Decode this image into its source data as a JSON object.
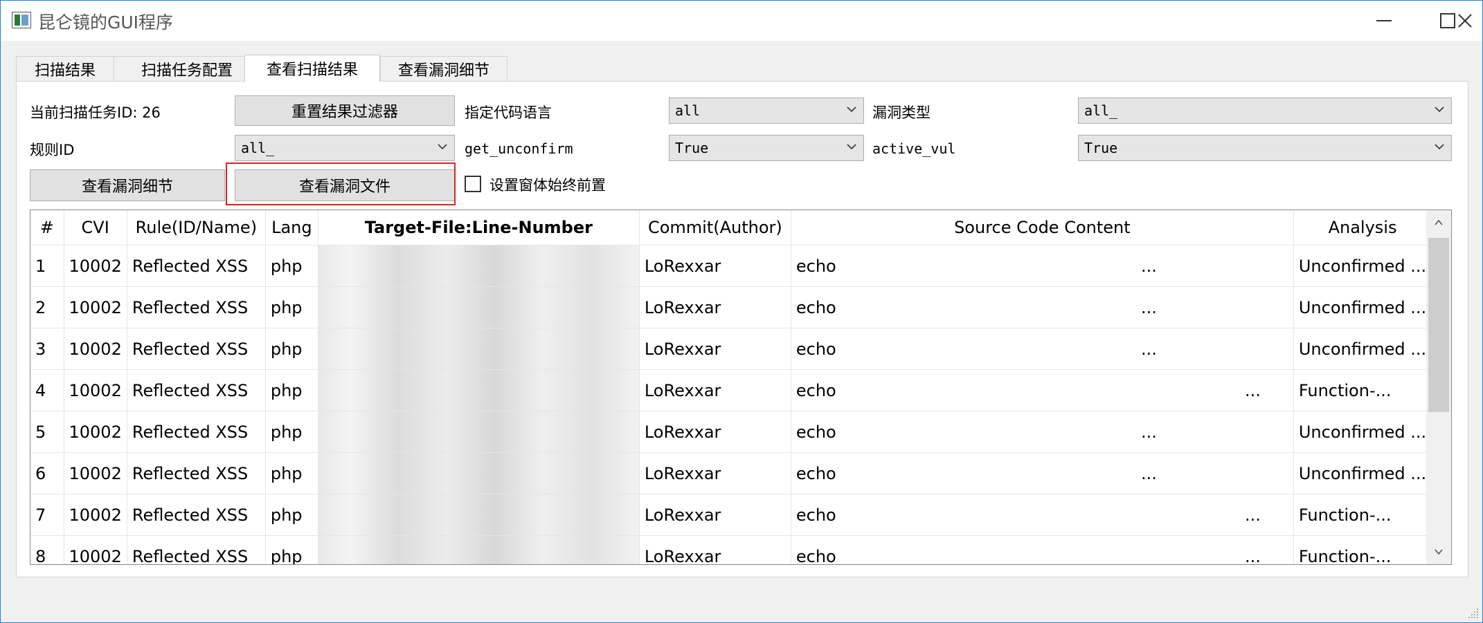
{
  "window": {
    "title": "昆仑镜的GUI程序"
  },
  "tabs": [
    {
      "label": "扫描结果",
      "active": false
    },
    {
      "label": "扫描任务配置",
      "active": false
    },
    {
      "label": "查看扫描结果",
      "active": true
    },
    {
      "label": "查看漏洞细节",
      "active": false
    }
  ],
  "controls": {
    "task_id_label": "当前扫描任务ID: 26",
    "reset_filter_button": "重置结果过滤器",
    "code_language_label": "指定代码语言",
    "code_language_value": "all",
    "vuln_type_label": "漏洞类型",
    "vuln_type_value": "all_",
    "rule_id_label": "规则ID",
    "rule_id_value": "all_",
    "get_unconfirm_label": "get_unconfirm",
    "get_unconfirm_value": "True",
    "active_vul_label": "active_vul",
    "active_vul_value": "True",
    "view_vuln_detail_button": "查看漏洞细节",
    "view_vuln_file_button": "查看漏洞文件",
    "always_on_top_label": "设置窗体始终前置",
    "always_on_top_checked": false
  },
  "table": {
    "columns": [
      "#",
      "CVI",
      "Rule(ID/Name)",
      "Lang",
      "Target-File:Line-Number",
      "Commit(Author)",
      "Source Code Content",
      "Analysis"
    ],
    "rows": [
      {
        "num": "1",
        "cvi": "10002",
        "rule": "Reflected XSS",
        "lang": "php",
        "target": "",
        "commit": "LoRexxar",
        "code": "echo",
        "code_tail": "...",
        "analysis": "Unconfirmed ..."
      },
      {
        "num": "2",
        "cvi": "10002",
        "rule": "Reflected XSS",
        "lang": "php",
        "target": "",
        "commit": "LoRexxar",
        "code": "echo",
        "code_tail": "...",
        "analysis": "Unconfirmed ..."
      },
      {
        "num": "3",
        "cvi": "10002",
        "rule": "Reflected XSS",
        "lang": "php",
        "target": "",
        "commit": "LoRexxar",
        "code": "echo",
        "code_tail": "...",
        "analysis": "Unconfirmed ..."
      },
      {
        "num": "4",
        "cvi": "10002",
        "rule": "Reflected XSS",
        "lang": "php",
        "target": "",
        "commit": "LoRexxar",
        "code": "echo",
        "code_tail": "...",
        "analysis": "Function-..."
      },
      {
        "num": "5",
        "cvi": "10002",
        "rule": "Reflected XSS",
        "lang": "php",
        "target": "",
        "commit": "LoRexxar",
        "code": "echo",
        "code_tail": "...",
        "analysis": "Unconfirmed ..."
      },
      {
        "num": "6",
        "cvi": "10002",
        "rule": "Reflected XSS",
        "lang": "php",
        "target": "",
        "commit": "LoRexxar",
        "code": "echo",
        "code_tail": "...",
        "analysis": "Unconfirmed ..."
      },
      {
        "num": "7",
        "cvi": "10002",
        "rule": "Reflected XSS",
        "lang": "php",
        "target": "",
        "commit": "LoRexxar",
        "code": "echo",
        "code_tail": "...",
        "analysis": "Function-..."
      },
      {
        "num": "8",
        "cvi": "10002",
        "rule": "Reflected XSS",
        "lang": "php",
        "target": "",
        "commit": "LoRexxar",
        "code": "echo",
        "code_tail": "...",
        "analysis": "Function-..."
      }
    ]
  },
  "colors": {
    "highlight": "#e02020",
    "window_border": "#1883d7"
  }
}
